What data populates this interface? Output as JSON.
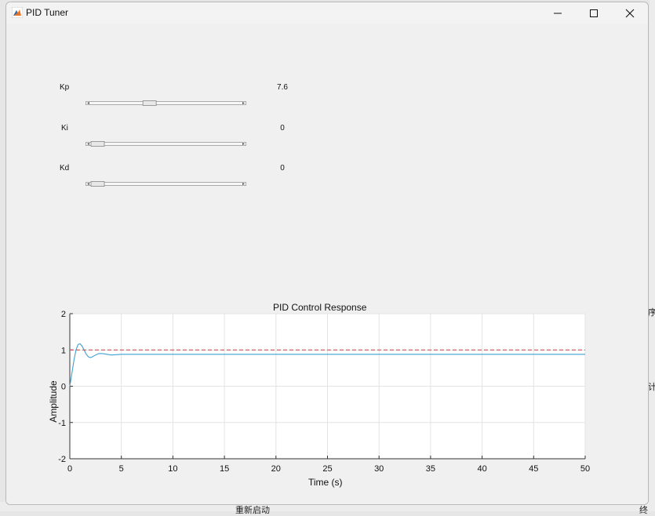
{
  "window": {
    "title": "PID Tuner"
  },
  "controls": [
    {
      "name": "Kp",
      "value": "7.6",
      "fraction": 0.38
    },
    {
      "name": "Ki",
      "value": "0",
      "fraction": 0.0
    },
    {
      "name": "Kd",
      "value": "0",
      "fraction": 0.0
    }
  ],
  "chart_data": {
    "type": "line",
    "title": "PID Control Response",
    "xlabel": "Time (s)",
    "ylabel": "Amplitude",
    "xlim": [
      0,
      50
    ],
    "ylim": [
      -2,
      2
    ],
    "xticks": [
      0,
      5,
      10,
      15,
      20,
      25,
      30,
      35,
      40,
      45,
      50
    ],
    "yticks": [
      -2,
      -1,
      0,
      1,
      2
    ],
    "grid": true,
    "series": [
      {
        "style": "solid",
        "color": "#3fa0d0",
        "x": [
          0,
          0.2,
          0.4,
          0.6,
          0.8,
          1.0,
          1.2,
          1.4,
          1.6,
          1.8,
          2.0,
          2.2,
          2.5,
          2.8,
          3.2,
          3.6,
          4.0,
          4.5,
          5.0,
          6.0,
          8.0,
          10,
          20,
          30,
          40,
          50
        ],
        "y": [
          0,
          0.35,
          0.72,
          1.0,
          1.15,
          1.17,
          1.1,
          0.99,
          0.88,
          0.81,
          0.79,
          0.81,
          0.86,
          0.9,
          0.9,
          0.88,
          0.86,
          0.87,
          0.88,
          0.88,
          0.88,
          0.88,
          0.88,
          0.88,
          0.88,
          0.88
        ]
      },
      {
        "style": "dashed",
        "color": "#d9534f",
        "x": [
          0,
          50
        ],
        "y": [
          1,
          1
        ]
      }
    ]
  },
  "colors": {
    "response": "#3fa0d0",
    "reference": "#d9534f"
  },
  "desktop_fragments": [
    "序",
    "计",
    "重新启动",
    "终"
  ]
}
